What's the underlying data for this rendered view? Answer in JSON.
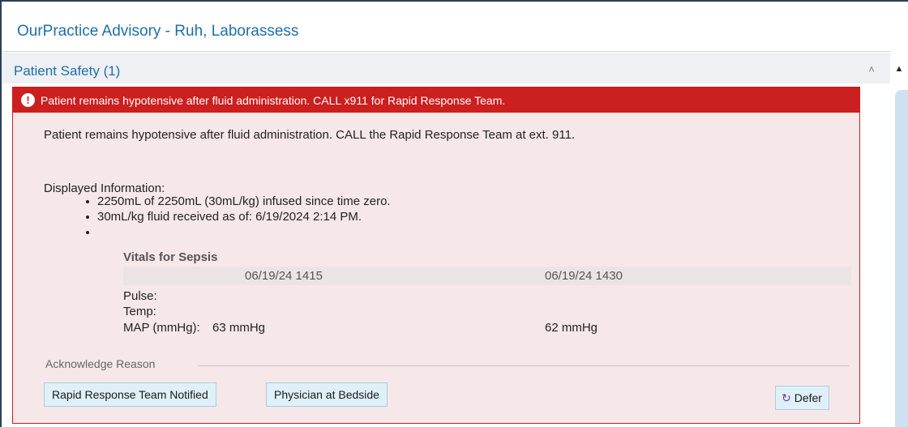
{
  "window": {
    "title": "OurPractice Advisory - Ruh, Laborassess"
  },
  "section": {
    "title": "Patient Safety (1)"
  },
  "advisory": {
    "header": "Patient remains hypotensive after fluid administration. CALL x911 for Rapid Response Team.",
    "message": "Patient remains hypotensive after fluid administration.  CALL the Rapid Response Team at ext. 911.",
    "displayed_label": "Displayed Information:",
    "info_items": [
      "2250mL of 2250mL (30mL/kg) infused since time zero.",
      "30mL/kg fluid received as of:  6/19/2024  2:14 PM.",
      ""
    ],
    "vitals": {
      "title": "Vitals for Sepsis",
      "columns": [
        "06/19/24 1415",
        "06/19/24 1430"
      ],
      "rows": [
        {
          "label": "Pulse:",
          "values": [
            "",
            ""
          ]
        },
        {
          "label": "Temp:",
          "values": [
            "",
            ""
          ]
        },
        {
          "label": "MAP (mmHg):",
          "values": [
            "63 mmHg",
            "62 mmHg"
          ]
        }
      ]
    },
    "acknowledge": {
      "label": "Acknowledge Reason",
      "buttons": [
        "Rapid Response Team Notified",
        "Physician at Bedside"
      ],
      "defer_label": "Defer"
    }
  },
  "colors": {
    "alert_red": "#cc1f1f",
    "card_bg": "#f6e8e8",
    "title_blue": "#1f6fa8",
    "button_bg": "#dff0f8"
  },
  "icons": {
    "alert": "exclamation-circle-icon",
    "collapse": "double-chevron-up-icon",
    "defer": "defer-clock-icon"
  }
}
